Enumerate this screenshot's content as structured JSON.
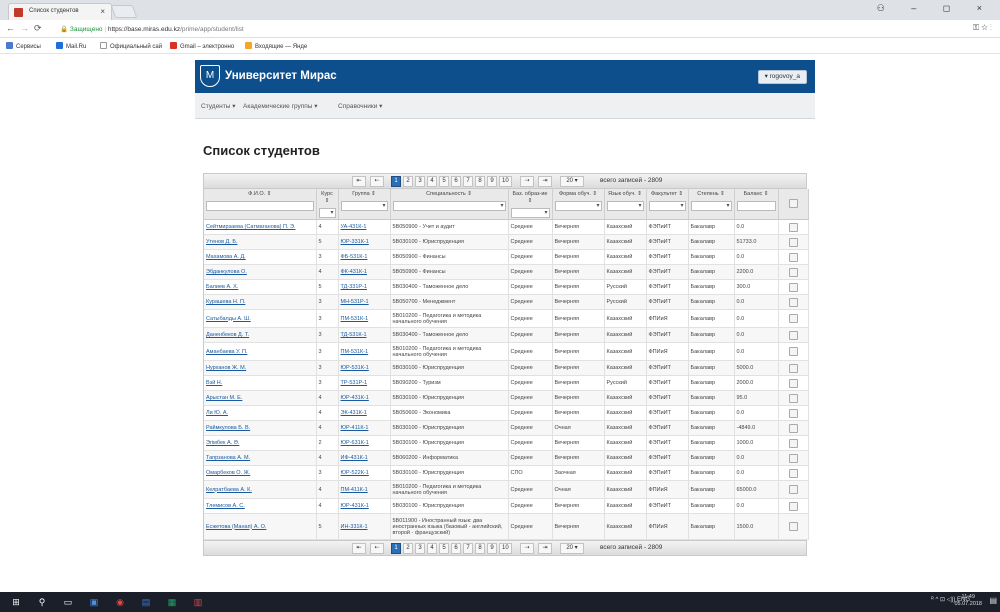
{
  "browser": {
    "tab_title": "Список студентов",
    "tab_close": "×",
    "url_secure": "Защищено",
    "url_host": "https://base.miras.edu.kz",
    "url_path": "/prime/app/student/list",
    "bookmarks": [
      "Сервисы",
      "Mail.Ru",
      "Официальный сай",
      "Gmail – электронно",
      "Входящие — Янде"
    ],
    "window_controls": "⚇ – ◻ ×"
  },
  "site": {
    "title": "Университет Мирас",
    "user": "▾ rogovoy_a",
    "menu": [
      "Студенты ▾",
      "Академические группы ▾",
      "Справочники ▾"
    ]
  },
  "page_title": "Список студентов",
  "pager": {
    "first": "⏮",
    "prev": "◀◀",
    "pages": [
      "1",
      "2",
      "3",
      "4",
      "5",
      "6",
      "7",
      "8",
      "9",
      "10"
    ],
    "next": "▶▶",
    "last": "⏭",
    "per_page": "20 ▾",
    "total_label": "всего записей - 2809"
  },
  "columns": [
    "Ф.И.О. ⇕",
    "Курс ⇕",
    "Группа ⇕",
    "Специальность ⇕",
    "Баз. образ-ие ⇕",
    "Форма обуч. ⇕",
    "Язык обуч. ⇕",
    "Факультет ⇕",
    "Степень ⇕",
    "Баланс ⇕",
    ""
  ],
  "rows": [
    [
      "Сейтмирзаева (Сатмаганова) П. Э.",
      "4",
      "УА-431К-1",
      "5В050900 - Учет и аудит",
      "Среднее",
      "Вечерняя",
      "Казахский",
      "ФЭПиИТ",
      "Бакалавр",
      "0.0"
    ],
    [
      "Утенов Д. Б.",
      "5",
      "ЮР-331К-1",
      "5В030100 - Юриспруденция",
      "Среднее",
      "Вечерняя",
      "Казахский",
      "ФЭПиИТ",
      "Бакалавр",
      "51733.0"
    ],
    [
      "Махамова А. Д.",
      "3",
      "ФБ-531К-1",
      "5В050900 - Финансы",
      "Среднее",
      "Вечерняя",
      "Казахский",
      "ФЭПиИТ",
      "Бакалавр",
      "0.0"
    ],
    [
      "Эбданкулова О.",
      "4",
      "ФК-431К-1",
      "5В050900 - Финансы",
      "Среднее",
      "Вечерняя",
      "Казахский",
      "ФЭПиИТ",
      "Бакалавр",
      "2200.0"
    ],
    [
      "Балиев А. Х.",
      "5",
      "ТД-331Р-1",
      "5В030400 - Таможенное дело",
      "Среднее",
      "Вечерняя",
      "Русский",
      "ФЭПиИТ",
      "Бакалавр",
      "300.0"
    ],
    [
      "Курашева Н. П.",
      "3",
      "МН-531Р-1",
      "5В050700 - Менеджмент",
      "Среднее",
      "Вечерняя",
      "Русский",
      "ФЭПиИТ",
      "Бакалавр",
      "0.0"
    ],
    [
      "Сатыбалды А. Ш.",
      "3",
      "ПМ-531К-1",
      "5В010200 - Педагогика и методика начального обучения",
      "Среднее",
      "Вечерняя",
      "Казахский",
      "ФПИиЯ",
      "Бакалавр",
      "0.0"
    ],
    [
      "Даненбеков Д. Т.",
      "3",
      "ТД-531К-1",
      "5В030400 - Таможенное дело",
      "Среднее",
      "Вечерняя",
      "Казахский",
      "ФЭПиИТ",
      "Бакалавр",
      "0.0"
    ],
    [
      "Аманбаева У. П.",
      "3",
      "ПМ-531К-1",
      "5В010200 - Педагогика и методика начального обучения",
      "Среднее",
      "Вечерняя",
      "Казахский",
      "ФПИиЯ",
      "Бакалавр",
      "0.0"
    ],
    [
      "Нурханов Ж. М.",
      "3",
      "ЮР-531К-1",
      "5В030100 - Юриспруденция",
      "Среднее",
      "Вечерняя",
      "Казахский",
      "ФЭПиИТ",
      "Бакалавр",
      "5000.0"
    ],
    [
      "Взй Н.",
      "3",
      "ТР-531Р-1",
      "5В090200 - Туризм",
      "Среднее",
      "Вечерняя",
      "Русский",
      "ФЭПиИТ",
      "Бакалавр",
      "2000.0"
    ],
    [
      "Арыстан М. Е.",
      "4",
      "ЮР-431К-1",
      "5В030100 - Юриспруденция",
      "Среднее",
      "Вечерняя",
      "Казахский",
      "ФЭПиИТ",
      "Бакалавр",
      "95.0"
    ],
    [
      "Ли Ю. А.",
      "4",
      "ЭК-431К-1",
      "5В050600 - Экономика",
      "Среднее",
      "Вечерняя",
      "Казахский",
      "ФЭПиИТ",
      "Бакалавр",
      "0.0"
    ],
    [
      "Раймкулова Б. В.",
      "4",
      "ЮР-411К-1",
      "5В030100 - Юриспруденция",
      "Среднее",
      "Очная",
      "Казахский",
      "ФЭПиИТ",
      "Бакалавр",
      "-4849.0"
    ],
    [
      "Эгімбек А. Ә.",
      "2",
      "ЮР-631К-1",
      "5В030100 - Юриспруденция",
      "Среднее",
      "Вечерняя",
      "Казахский",
      "ФЭПиИТ",
      "Бакалавр",
      "1000.0"
    ],
    [
      "Тапрзанова А. М.",
      "4",
      "ИФ-431К-1",
      "5В060200 - Информатика",
      "Среднее",
      "Вечерняя",
      "Казахский",
      "ФЭПиИТ",
      "Бакалавр",
      "0.0"
    ],
    [
      "Омарбеков О. Ж.",
      "3",
      "ЮР-522К-1",
      "5В030100 - Юриспруденция",
      "СПО",
      "Заочная",
      "Казахский",
      "ФЭПиИТ",
      "Бакалавр",
      "0.0"
    ],
    [
      "Келратбаева А. К.",
      "4",
      "ПМ-411К-1",
      "5В010200 - Педагогика и методика начального обучения",
      "Среднее",
      "Очная",
      "Казахский",
      "ФПИиЯ",
      "Бакалавр",
      "65000.0"
    ],
    [
      "Тлемисов А. С.",
      "4",
      "ЮР-431К-1",
      "5В030100 - Юриспруденция",
      "Среднее",
      "Вечерняя",
      "Казахский",
      "ФЭПиИТ",
      "Бакалавр",
      "0.0"
    ],
    [
      "Есжетова (Манап) А. О.",
      "5",
      "ИН-331К-1",
      "5В011900 - Иностранный язык: два иностранных языка (базовый - английский, второй - французский)",
      "Среднее",
      "Вечерняя",
      "Казахский",
      "ФПИиЯ",
      "Бакалавр",
      "1500.0"
    ]
  ],
  "taskbar": {
    "lang": "ENG",
    "time": "11:49",
    "date": "05.07.2018"
  }
}
